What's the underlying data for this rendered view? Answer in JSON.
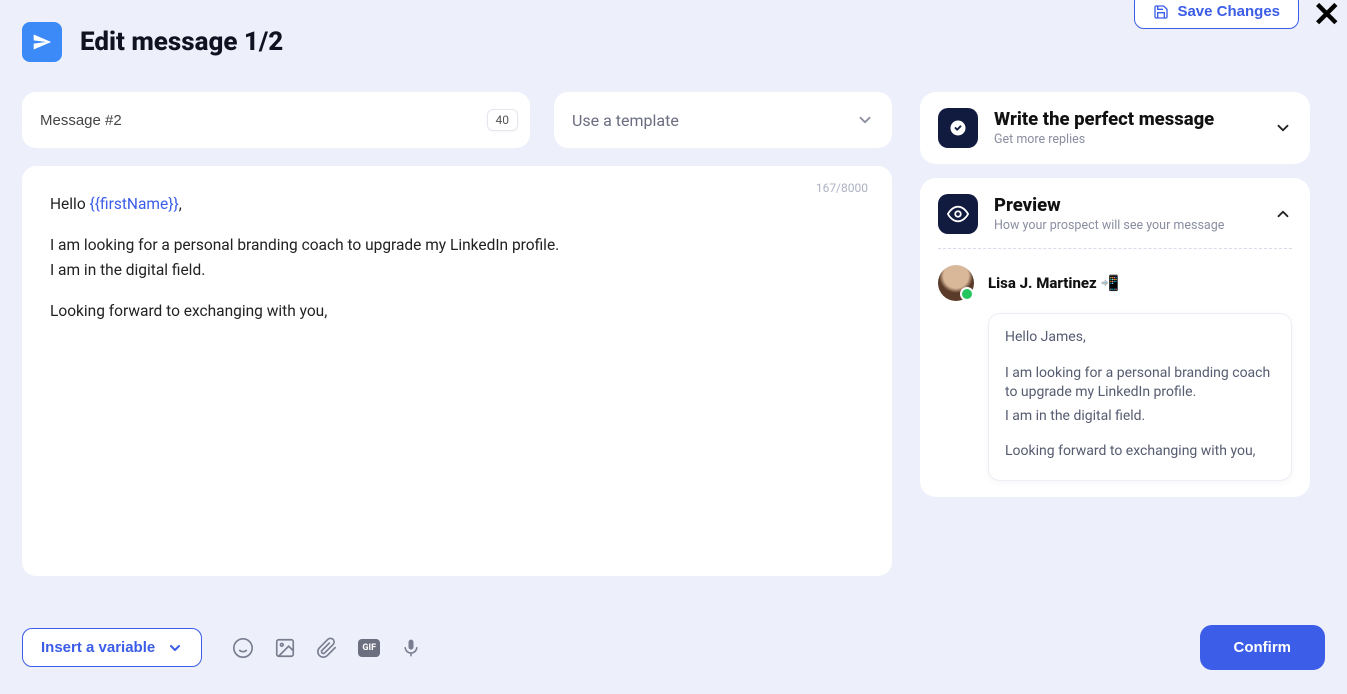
{
  "header": {
    "title": "Edit message 1/2",
    "save_label": "Save Changes"
  },
  "message": {
    "label": "Message #2",
    "badge": "40",
    "template_placeholder": "Use a template",
    "counter": "167/8000",
    "greeting_prefix": "Hello ",
    "greeting_var": "{{firstName}}",
    "greeting_suffix": ",",
    "line1": "I am looking for a personal branding coach to upgrade my LinkedIn profile.",
    "line2": "I am in the digital field.",
    "closing": "Looking forward to exchanging with you,"
  },
  "toolbar": {
    "insert_label": "Insert a variable",
    "gif_label": "GIF",
    "confirm_label": "Confirm"
  },
  "right": {
    "perfect": {
      "title": "Write the perfect message",
      "sub": "Get more replies"
    },
    "preview": {
      "title": "Preview",
      "sub": "How your prospect will see your message",
      "name": "Lisa J. Martinez 📲",
      "greeting": "Hello James,",
      "line1": "I am looking for a personal branding coach to upgrade my LinkedIn profile.",
      "line2": "I am in the digital field.",
      "closing": "Looking forward to exchanging with you,"
    }
  }
}
